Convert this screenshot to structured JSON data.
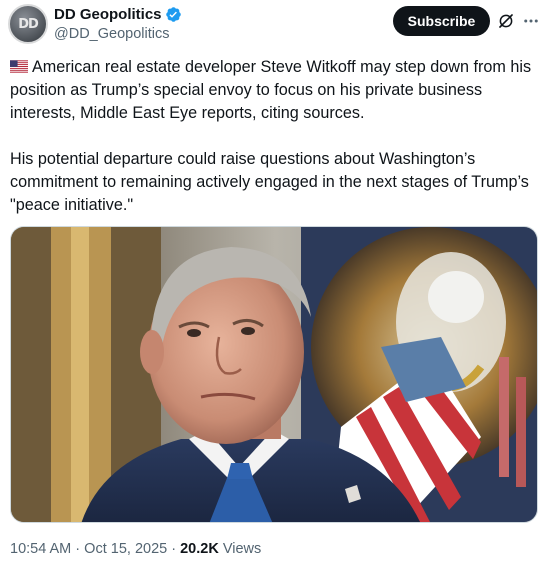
{
  "author": {
    "avatar_text": "DD",
    "name": "DD Geopolitics",
    "handle": "@DD_Geopolitics",
    "verified": true
  },
  "header": {
    "subscribe_label": "Subscribe",
    "grok_icon": "grok-icon",
    "more_icon": "more-icon"
  },
  "tweet": {
    "flag_icon": "us-flag-emoji",
    "paragraph1": "American real estate developer Steve Witkoff may step down from his position as Trump’s special envoy to focus on his private business interests, Middle East Eye reports, citing sources.",
    "paragraph2": "His potential departure could raise questions about Washington’s commitment to remaining actively engaged in the next stages of Trump’s \"peace initiative.\""
  },
  "meta": {
    "time": "10:54 AM",
    "separator": "·",
    "date": "Oct 15, 2025",
    "views_count": "20.2K",
    "views_label": "Views"
  },
  "colors": {
    "accent": "#1d9bf0",
    "text": "#0f1419",
    "secondary": "#536471"
  }
}
